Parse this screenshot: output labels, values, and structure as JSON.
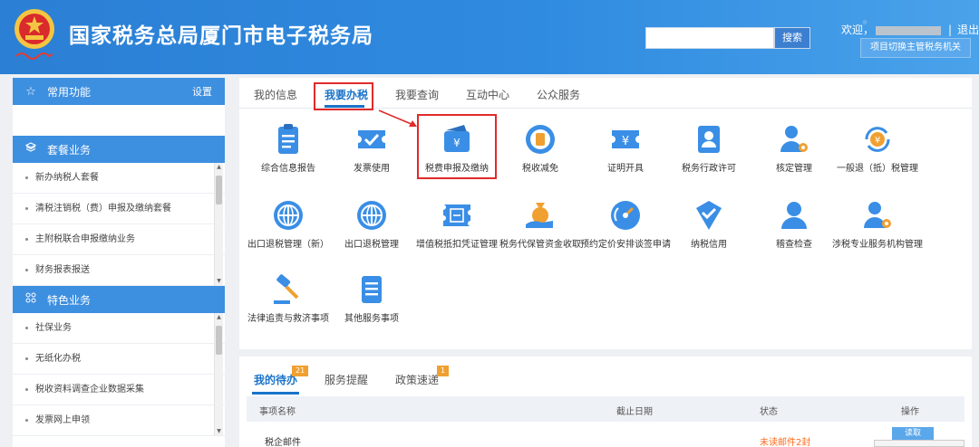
{
  "header": {
    "site_title": "国家税务总局厦门市电子税务局",
    "search_button": "搜索",
    "welcome": "欢迎，",
    "separator": "|",
    "logout": "退出",
    "switch_button": "项目切换主管税务机关"
  },
  "sidebar": {
    "favorites": {
      "title": "常用功能",
      "action": "设置"
    },
    "packages": {
      "title": "套餐业务",
      "items": [
        "新办纳税人套餐",
        "清税注销税（费）申报及缴纳套餐",
        "主附税联合申报缴纳业务",
        "财务报表报送"
      ]
    },
    "special": {
      "title": "特色业务",
      "items": [
        "社保业务",
        "无纸化办税",
        "税收资料调查企业数据采集",
        "发票网上申领"
      ]
    }
  },
  "main": {
    "tabs": [
      "我的信息",
      "我要办税",
      "我要查询",
      "互动中心",
      "公众服务"
    ],
    "active_tab": "我要办税",
    "services_row1": [
      "综合信息报告",
      "发票使用",
      "税费申报及缴纳",
      "税收减免",
      "证明开具",
      "税务行政许可",
      "核定管理",
      "一般退（抵）税管理"
    ],
    "services_row2": [
      "出口退税管理（新）",
      "出口退税管理",
      "增值税抵扣凭证管理",
      "税务代保管资金收取",
      "预约定价安排谈签申请",
      "纳税信用",
      "稽查检查",
      "涉税专业服务机构管理"
    ],
    "services_row3": [
      "法律追责与救济事项",
      "其他服务事项"
    ],
    "highlighted_service": "税费申报及缴纳"
  },
  "tasks": {
    "tabs": [
      "我的待办",
      "服务提醒",
      "政策速递"
    ],
    "badges": [
      "21",
      "1"
    ],
    "columns": [
      "事项名称",
      "截止日期",
      "状态",
      "操作"
    ],
    "rows": [
      {
        "name": "税企邮件",
        "deadline": "",
        "status": "未读邮件2封",
        "action": "读取"
      }
    ]
  },
  "colors": {
    "header_blue": "#2f8be0",
    "accent_blue": "#1a73c9",
    "highlight_red": "#e02a2a",
    "icon_blue": "#3a8ee6",
    "badge_orange": "#f0a030",
    "status_orange": "#ff6a1a"
  },
  "icons": {
    "services_row1": [
      "clipboard-icon",
      "ticket-check-icon",
      "wallet-yuan-icon",
      "coin-stack-icon",
      "yuan-ticket-icon",
      "badge-card-icon",
      "person-gear-icon",
      "yuan-cycle-icon"
    ],
    "services_row2": [
      "globe-icon",
      "globe-icon",
      "invoice-icon",
      "money-bag-hand-icon",
      "gauge-icon",
      "shield-check-icon",
      "person-icon",
      "person-gear-icon"
    ],
    "services_row3": [
      "gavel-icon",
      "document-icon"
    ]
  }
}
